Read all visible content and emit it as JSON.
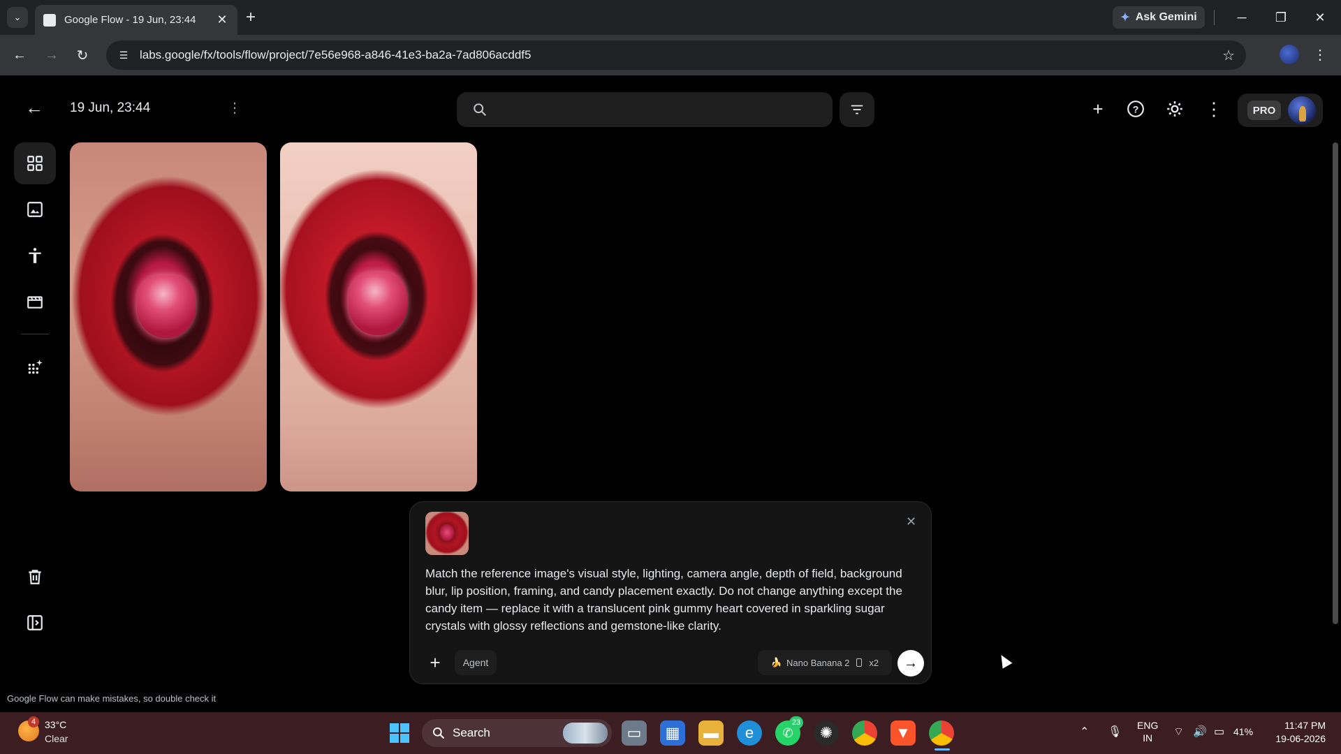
{
  "browser": {
    "tab_title": "Google Flow - 19 Jun, 23:44",
    "ask_gemini_label": "Ask Gemini",
    "url": "labs.google/fx/tools/flow/project/7e56e968-a846-41e3-ba2a-7ad806acddf5"
  },
  "header": {
    "project_title": "19 Jun, 23:44",
    "search_placeholder": "",
    "pro_label": "PRO"
  },
  "sidebar": {
    "items": [
      {
        "name": "grid-view",
        "icon": "grid-icon",
        "active": true
      },
      {
        "name": "images",
        "icon": "image-icon",
        "active": false
      },
      {
        "name": "characters",
        "icon": "person-icon",
        "active": false
      },
      {
        "name": "scenes",
        "icon": "clapperboard-icon",
        "active": false
      },
      {
        "name": "tools",
        "icon": "sparkle-grid-icon",
        "active": false
      },
      {
        "name": "trash",
        "icon": "trash-icon",
        "active": false
      },
      {
        "name": "panel",
        "icon": "side-panel-icon",
        "active": false
      }
    ]
  },
  "gallery": {
    "images": [
      {
        "alt": "red lips holding pink gem candy (1)"
      },
      {
        "alt": "red lips holding pink gem candy (2)"
      }
    ]
  },
  "composer": {
    "prompt": "Match the reference image's visual style, lighting, camera angle, depth of field, background blur, lip position, framing, and candy placement exactly. Do not change anything except the candy item — replace it with a translucent pink gummy heart covered in sparkling sugar crystals with glossy reflections and gemstone-like clarity.",
    "agent_label": "Agent",
    "model_label": "Nano Banana 2",
    "count_label": "x2"
  },
  "disclaimer": "Google Flow can make mistakes, so double check it",
  "taskbar": {
    "weather_badge": "4",
    "temperature": "33°C",
    "condition": "Clear",
    "search_label": "Search",
    "whatsapp_badge": "23",
    "lang_top": "ENG",
    "lang_bottom": "IN",
    "battery": "41%",
    "time": "11:47 PM",
    "date": "19-06-2026"
  },
  "colors": {
    "app_bg": "#000000",
    "panel_bg": "#141414",
    "taskbar_bg": "#3b1d22",
    "chrome_bg": "#35363a"
  }
}
